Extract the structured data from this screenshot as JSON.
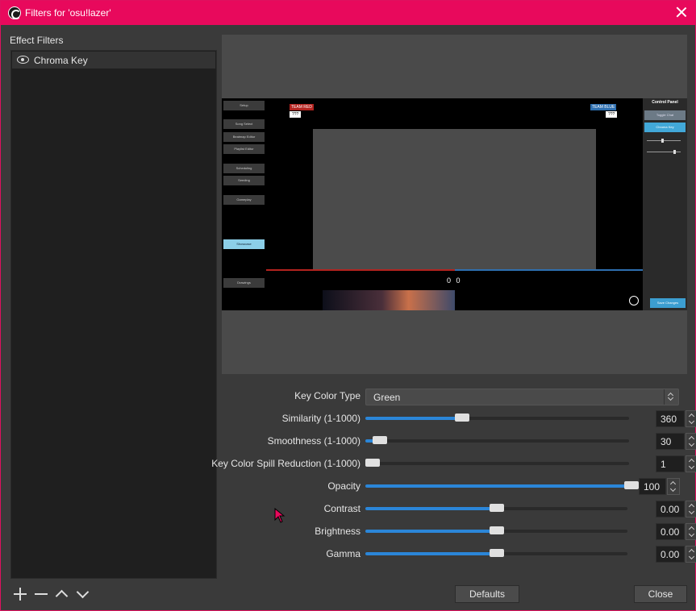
{
  "window": {
    "title": "Filters for 'osu!lazer'"
  },
  "colors": {
    "titlebar": "#e8095c",
    "accent": "#2b86d8",
    "list_bg": "#1f1f1f",
    "cursor": "#e8095c"
  },
  "filters": {
    "heading": "Effect Filters",
    "items": [
      {
        "name": "Chroma Key",
        "visible_icon": "eye-icon"
      }
    ],
    "tools": {
      "add_icon": "plus-icon",
      "remove_icon": "minus-icon",
      "up_icon": "chevron-up-icon",
      "down_icon": "chevron-down-icon"
    }
  },
  "preview": {
    "left_buttons": [
      "Setup",
      "Song Select",
      "Beatmap Editor",
      "Playlist Editor",
      "Scheduling",
      "Seeding",
      "Gameplay",
      "Showcase",
      "Drawings"
    ],
    "team_red": {
      "label": "TEAM RED",
      "score": "???"
    },
    "team_blue": {
      "label": "TEAM BLUE",
      "score": "???"
    },
    "score_display": "0 0",
    "control_panel": {
      "title": "Control Panel",
      "buttons": [
        "Toggle Chat",
        "Chroma Key"
      ],
      "save_button": "Save Changes"
    }
  },
  "properties": {
    "key_color_type": {
      "label": "Key Color Type",
      "value": "Green"
    },
    "sliders": [
      {
        "id": "similarity",
        "label": "Similarity (1-1000)",
        "value": "360",
        "fraction": 0.36
      },
      {
        "id": "smoothness",
        "label": "Smoothness (1-1000)",
        "value": "30",
        "fraction": 0.03
      },
      {
        "id": "spill",
        "label": "Key Color Spill Reduction (1-1000)",
        "value": "1",
        "fraction": 0.0
      },
      {
        "id": "opacity",
        "label": "Opacity",
        "value": "100",
        "fraction": 1.0
      },
      {
        "id": "contrast",
        "label": "Contrast",
        "value": "0.00",
        "fraction": 0.5
      },
      {
        "id": "brightness",
        "label": "Brightness",
        "value": "0.00",
        "fraction": 0.5
      },
      {
        "id": "gamma",
        "label": "Gamma",
        "value": "0.00",
        "fraction": 0.5
      }
    ]
  },
  "buttons": {
    "defaults": "Defaults",
    "close": "Close"
  }
}
